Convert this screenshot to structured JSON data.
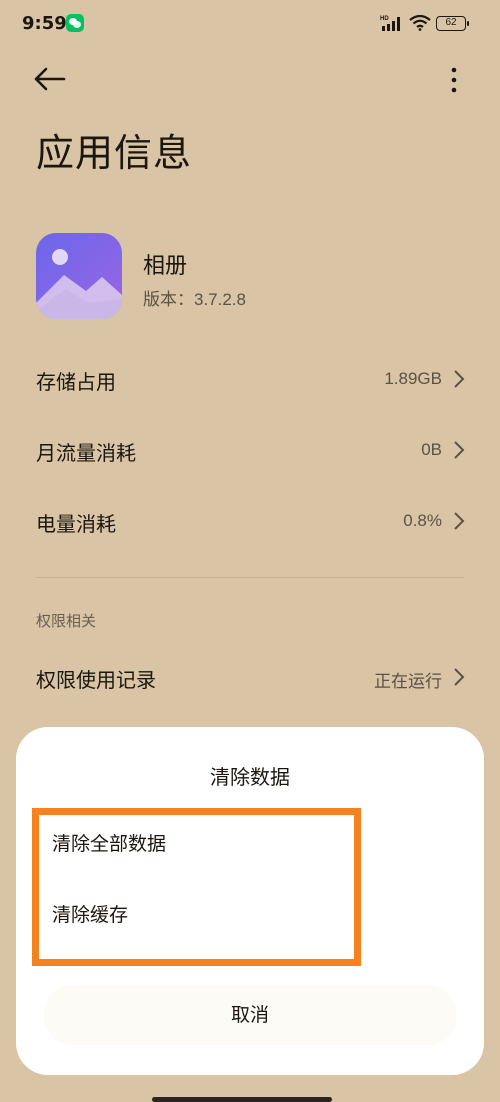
{
  "status_bar": {
    "time": "9:59",
    "battery": "62",
    "network": "HD"
  },
  "header": {
    "title": "应用信息"
  },
  "app": {
    "name": "相册",
    "version": "版本：3.7.2.8"
  },
  "rows": [
    {
      "label": "存储占用",
      "value": "1.89GB"
    },
    {
      "label": "月流量消耗",
      "value": "0B"
    },
    {
      "label": "电量消耗",
      "value": "0.8%"
    }
  ],
  "permissions": {
    "section_label": "权限相关",
    "row": {
      "label": "权限使用记录",
      "value": "正在运行"
    }
  },
  "dialog": {
    "title": "清除数据",
    "options": [
      "清除全部数据",
      "清除缓存"
    ],
    "cancel": "取消"
  },
  "colors": {
    "background": "#d9c5a5",
    "highlight": "#f5821f",
    "sheet": "#ffffff"
  }
}
